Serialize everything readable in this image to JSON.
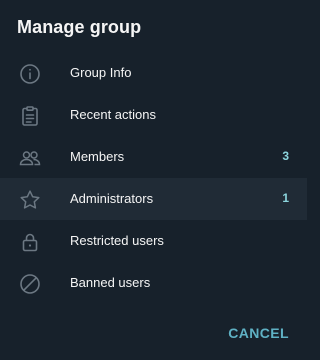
{
  "dialog": {
    "title": "Manage group",
    "items": [
      {
        "label": "Group Info",
        "icon": "info-icon",
        "count": ""
      },
      {
        "label": "Recent actions",
        "icon": "clipboard-icon",
        "count": ""
      },
      {
        "label": "Members",
        "icon": "members-icon",
        "count": "3"
      },
      {
        "label": "Administrators",
        "icon": "star-icon",
        "count": "1"
      },
      {
        "label": "Restricted users",
        "icon": "lock-icon",
        "count": ""
      },
      {
        "label": "Banned users",
        "icon": "block-icon",
        "count": ""
      }
    ],
    "cancel_label": "CANCEL"
  },
  "colors": {
    "background": "#17212b",
    "hover_row": "#202b36",
    "text": "#f5f5f5",
    "icon": "#6c7883",
    "count": "#8bd5dd",
    "accent": "#5fb1c4"
  }
}
